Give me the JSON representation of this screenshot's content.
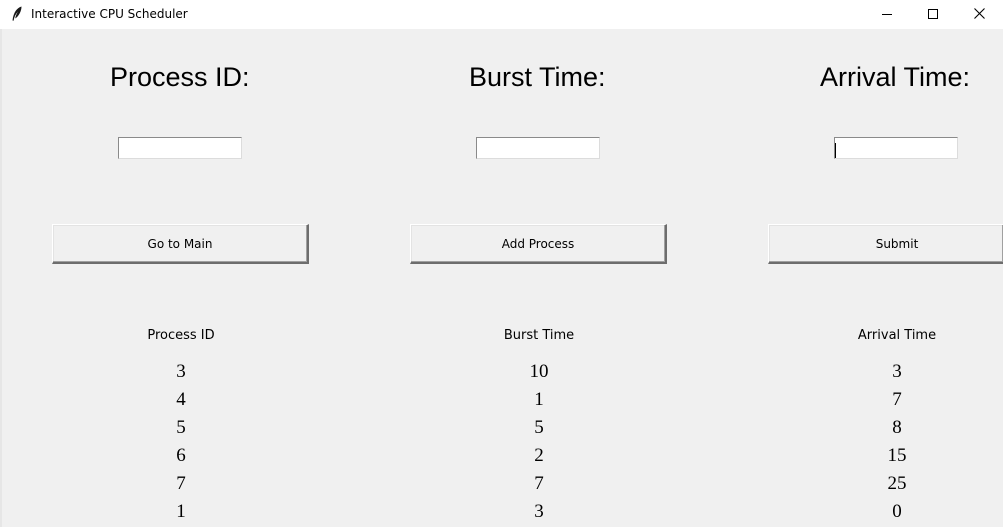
{
  "window": {
    "title": "Interactive CPU Scheduler",
    "controls": {
      "minimize": "minimize-icon",
      "maximize": "maximize-icon",
      "close": "close-icon"
    }
  },
  "form": {
    "headings": {
      "process_id": "Process ID:",
      "burst_time": "Burst Time:",
      "arrival_time": "Arrival Time:"
    },
    "inputs": {
      "process_id": "",
      "burst_time": "",
      "arrival_time": ""
    }
  },
  "buttons": {
    "go_to_main": "Go to Main",
    "add_process": "Add Process",
    "submit": "Submit"
  },
  "table": {
    "headers": [
      "Process ID",
      "Burst Time",
      "Arrival Time"
    ],
    "rows": [
      [
        "3",
        "10",
        "3"
      ],
      [
        "4",
        "1",
        "7"
      ],
      [
        "5",
        "5",
        "8"
      ],
      [
        "6",
        "2",
        "15"
      ],
      [
        "7",
        "7",
        "25"
      ],
      [
        "1",
        "3",
        "0"
      ]
    ]
  }
}
